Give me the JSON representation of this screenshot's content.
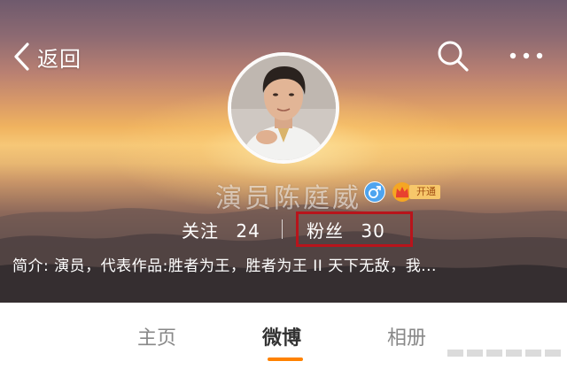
{
  "nav": {
    "back_label": "返回",
    "icons": {
      "back": "chevron-left-icon",
      "search": "search-icon",
      "more": "more-dots-icon"
    }
  },
  "profile": {
    "name": "演员陈庭威",
    "gender_icon": "male-icon",
    "vip_badge_label": "开通",
    "stats": {
      "following_label": "关注",
      "following_count": "24",
      "fans_label": "粉丝",
      "fans_count": "30"
    },
    "bio": "简介: 演员，代表作品:胜者为王，胜者为王 II 天下无敌，我..."
  },
  "tabs": [
    {
      "label": "主页"
    },
    {
      "label": "微博"
    },
    {
      "label": "相册"
    }
  ],
  "colors": {
    "accent_orange": "#ff8200",
    "highlight_red": "#b8141b",
    "gender_blue": "#4ea4ef"
  }
}
